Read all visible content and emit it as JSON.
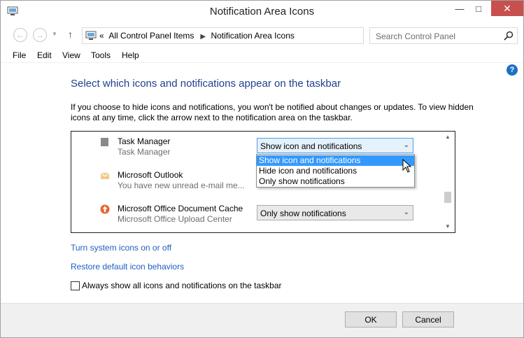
{
  "window": {
    "title": "Notification Area Icons"
  },
  "address_bar": {
    "prefix": "«",
    "crumbs": [
      "All Control Panel Items",
      "Notification Area Icons"
    ],
    "search_placeholder": "Search Control Panel"
  },
  "menu": [
    "File",
    "Edit",
    "View",
    "Tools",
    "Help"
  ],
  "content": {
    "heading": "Select which icons and notifications appear on the taskbar",
    "description": "If you choose to hide icons and notifications, you won't be notified about changes or updates. To view hidden icons at any time, click the arrow next to the notification area on the taskbar.",
    "rows": [
      {
        "name": "Task Manager",
        "desc": "Task Manager",
        "behavior": "Show icon and notifications",
        "icon": "task-manager-icon"
      },
      {
        "name": "Microsoft Outlook",
        "desc": "You have new unread e-mail me...",
        "behavior": "",
        "icon": "envelope-icon"
      },
      {
        "name": "Microsoft Office Document Cache",
        "desc": "Microsoft Office Upload Center",
        "behavior": "Only show notifications",
        "icon": "upload-arrow-icon"
      }
    ],
    "dropdown_options": [
      "Show icon and notifications",
      "Hide icon and notifications",
      "Only show notifications"
    ],
    "dropdown_selected_index": 0,
    "link_system_icons": "Turn system icons on or off",
    "link_restore": "Restore default icon behaviors",
    "always_show_label": "Always show all icons and notifications on the taskbar",
    "always_show_checked": false
  },
  "buttons": {
    "ok": "OK",
    "cancel": "Cancel"
  },
  "colors": {
    "heading": "#1e3f8f",
    "link": "#1e5fc1",
    "selection": "#3399ff",
    "close_button": "#c7504e"
  }
}
